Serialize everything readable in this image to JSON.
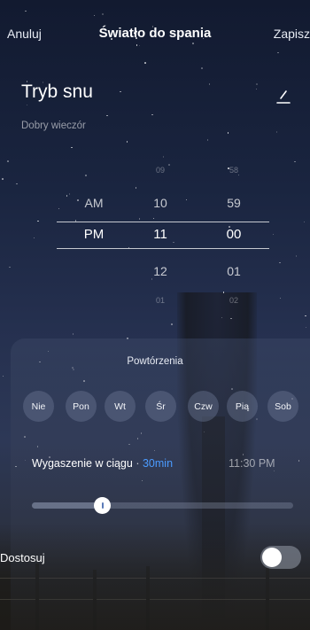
{
  "topbar": {
    "cancel_label": "Anuluj",
    "title": "Światło do spania",
    "save_label": "Zapisz"
  },
  "mode": {
    "title": "Tryb snu",
    "greeting": "Dobry wieczór",
    "edit_icon": "pencil-icon"
  },
  "time_picker": {
    "ampm": [
      "AM",
      "PM"
    ],
    "hours": [
      "09",
      "10",
      "11",
      "12",
      "01"
    ],
    "minutes": [
      "58",
      "59",
      "00",
      "01",
      "02"
    ],
    "selected": {
      "ampm": "PM",
      "hour": "11",
      "minute": "00"
    }
  },
  "repeat": {
    "title": "Powtórzenia",
    "days": [
      "Nie",
      "Pon",
      "Wt",
      "Śr",
      "Czw",
      "Pią",
      "Sob"
    ]
  },
  "fade": {
    "label": "Wygaszenie w ciągu",
    "separator": "·",
    "duration": "30min",
    "end_time": "11:30 PM",
    "slider_level": 0.27
  },
  "customize": {
    "label": "Dostosuj",
    "toggle_on": false
  },
  "colors": {
    "accent": "#4b9bff",
    "text": "#ffffff",
    "muted": "#8c93a3"
  }
}
